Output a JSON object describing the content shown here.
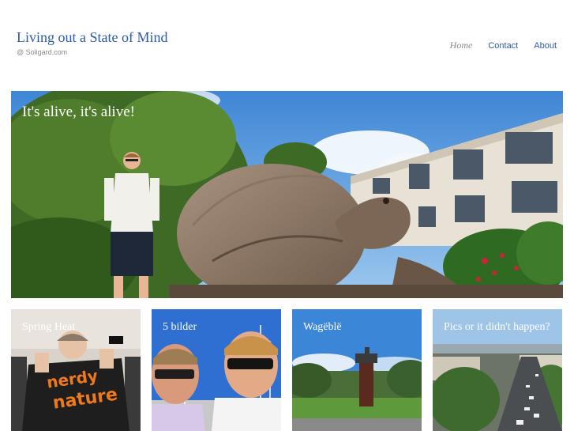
{
  "site": {
    "title": "Living out a State of Mind",
    "tagline": "@ Soligard.com"
  },
  "nav": {
    "items": [
      {
        "label": "Home",
        "current": true
      },
      {
        "label": "Contact",
        "current": false
      },
      {
        "label": "About",
        "current": false
      }
    ]
  },
  "hero": {
    "caption": "It's alive, it's alive!"
  },
  "tiles": [
    {
      "caption": "Spring Heat"
    },
    {
      "caption": "5 bilder"
    },
    {
      "caption": "Wagëblë"
    },
    {
      "caption": "Pics or it didn't happen?"
    }
  ],
  "shirt_text": [
    "nerdy",
    "nature"
  ],
  "colors": {
    "link": "#2b5ba8",
    "muted": "#8a8a8a",
    "caption": "#ffffff"
  }
}
